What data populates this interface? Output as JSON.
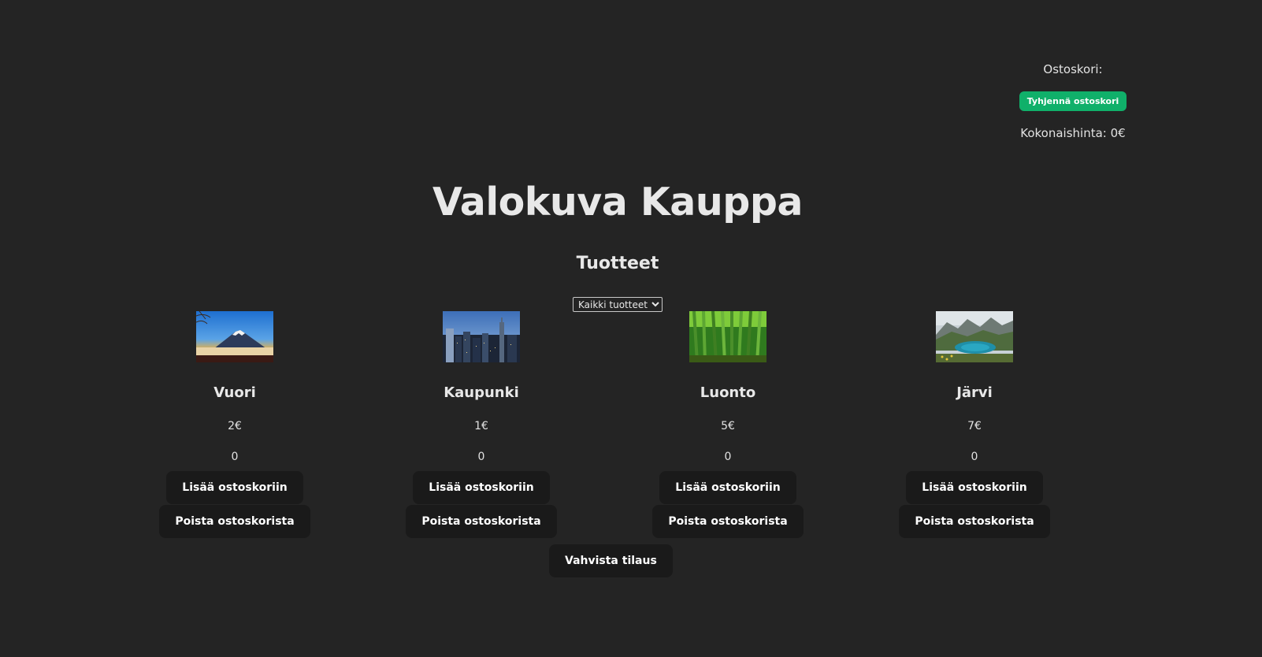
{
  "cart": {
    "title": "Ostoskori:",
    "clear_label": "Tyhjennä ostoskori",
    "total_label": "Kokonaishinta: 0€"
  },
  "header": {
    "title": "Valokuva Kauppa",
    "subtitle": "Tuotteet"
  },
  "filter": {
    "selected": "Kaikki tuotteet"
  },
  "products": [
    {
      "name": "Vuori",
      "price": "2€",
      "qty": "0",
      "add_label": "Lisää ostoskoriin",
      "remove_label": "Poista ostoskorista",
      "image_icon": "mountain-photo"
    },
    {
      "name": "Kaupunki",
      "price": "1€",
      "qty": "0",
      "add_label": "Lisää ostoskoriin",
      "remove_label": "Poista ostoskorista",
      "image_icon": "city-photo"
    },
    {
      "name": "Luonto",
      "price": "5€",
      "qty": "0",
      "add_label": "Lisää ostoskoriin",
      "remove_label": "Poista ostoskorista",
      "image_icon": "forest-photo"
    },
    {
      "name": "Järvi",
      "price": "7€",
      "qty": "0",
      "add_label": "Lisää ostoskoriin",
      "remove_label": "Poista ostoskorista",
      "image_icon": "lake-photo"
    }
  ],
  "confirm_label": "Vahvista tilaus",
  "colors": {
    "background": "#242424",
    "accent": "#10b06a",
    "button": "#1a1a1a"
  }
}
